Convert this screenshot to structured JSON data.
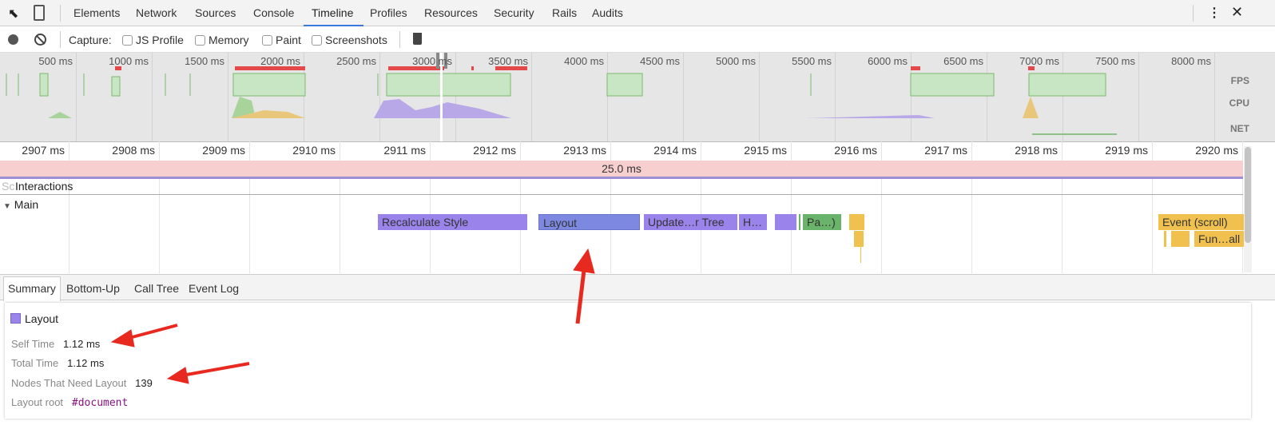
{
  "tabs": [
    "Elements",
    "Network",
    "Sources",
    "Console",
    "Timeline",
    "Profiles",
    "Resources",
    "Security",
    "Rails",
    "Audits"
  ],
  "active_tab": "Timeline",
  "toolbar": {
    "capture_label": "Capture:",
    "options": [
      "JS Profile",
      "Memory",
      "Paint",
      "Screenshots"
    ]
  },
  "overview": {
    "ticks": [
      "500 ms",
      "1000 ms",
      "1500 ms",
      "2000 ms",
      "2500 ms",
      "3000 ms",
      "3500 ms",
      "4000 ms",
      "4500 ms",
      "5000 ms",
      "5500 ms",
      "6000 ms",
      "6500 ms",
      "7000 ms",
      "7500 ms",
      "8000 ms"
    ],
    "rows": [
      "FPS",
      "CPU",
      "NET"
    ]
  },
  "ruler": {
    "ticks": [
      "2907 ms",
      "2908 ms",
      "2909 ms",
      "2910 ms",
      "2911 ms",
      "2912 ms",
      "2913 ms",
      "2914 ms",
      "2915 ms",
      "2916 ms",
      "2917 ms",
      "2918 ms",
      "2919 ms",
      "2920 ms"
    ]
  },
  "frame_label": "25.0 ms",
  "tracks": {
    "interactions_prefix": "Sc",
    "interactions": "Interactions",
    "main": "Main"
  },
  "flame": {
    "recalc": "Recalculate Style",
    "layout": "Layout",
    "update": "Update…r Tree",
    "h": "H…",
    "paint": "Pa…)",
    "event": "Event (scroll)",
    "fun": "Fun…all"
  },
  "detail_tabs": [
    "Summary",
    "Bottom-Up",
    "Call Tree",
    "Event Log"
  ],
  "summary": {
    "title": "Layout",
    "color": "#9a83ea",
    "self_time_label": "Self Time",
    "self_time": "1.12 ms",
    "total_time_label": "Total Time",
    "total_time": "1.12 ms",
    "nodes_label": "Nodes That Need Layout",
    "nodes": "139",
    "root_label": "Layout root",
    "root": "#document"
  },
  "colors": {
    "accent": "#3879d9",
    "annotation_arrow": "#e8291f"
  }
}
